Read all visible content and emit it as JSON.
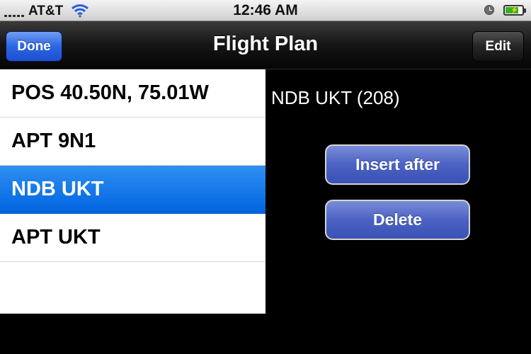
{
  "status_bar": {
    "carrier": "AT&T",
    "time": "12:46 AM",
    "icons": [
      "signal-icon",
      "wifi-icon",
      "alarm-clock-icon",
      "battery-charging-icon"
    ],
    "battery_level": 0.8
  },
  "navbar": {
    "title": "Flight Plan",
    "done_label": "Done",
    "edit_label": "Edit"
  },
  "waypoints": [
    {
      "label": "POS 40.50N, 75.01W",
      "selected": false
    },
    {
      "label": "APT 9N1",
      "selected": false
    },
    {
      "label": "NDB UKT",
      "selected": true
    },
    {
      "label": "APT UKT",
      "selected": false
    },
    {
      "label": "",
      "selected": false
    }
  ],
  "detail": {
    "title": "NDB UKT (208)",
    "insert_after_label": "Insert after",
    "delete_label": "Delete"
  },
  "colors": {
    "selection": "#0a6fe8",
    "done_button": "#2d66e2",
    "action_button": "#4c62c4"
  }
}
